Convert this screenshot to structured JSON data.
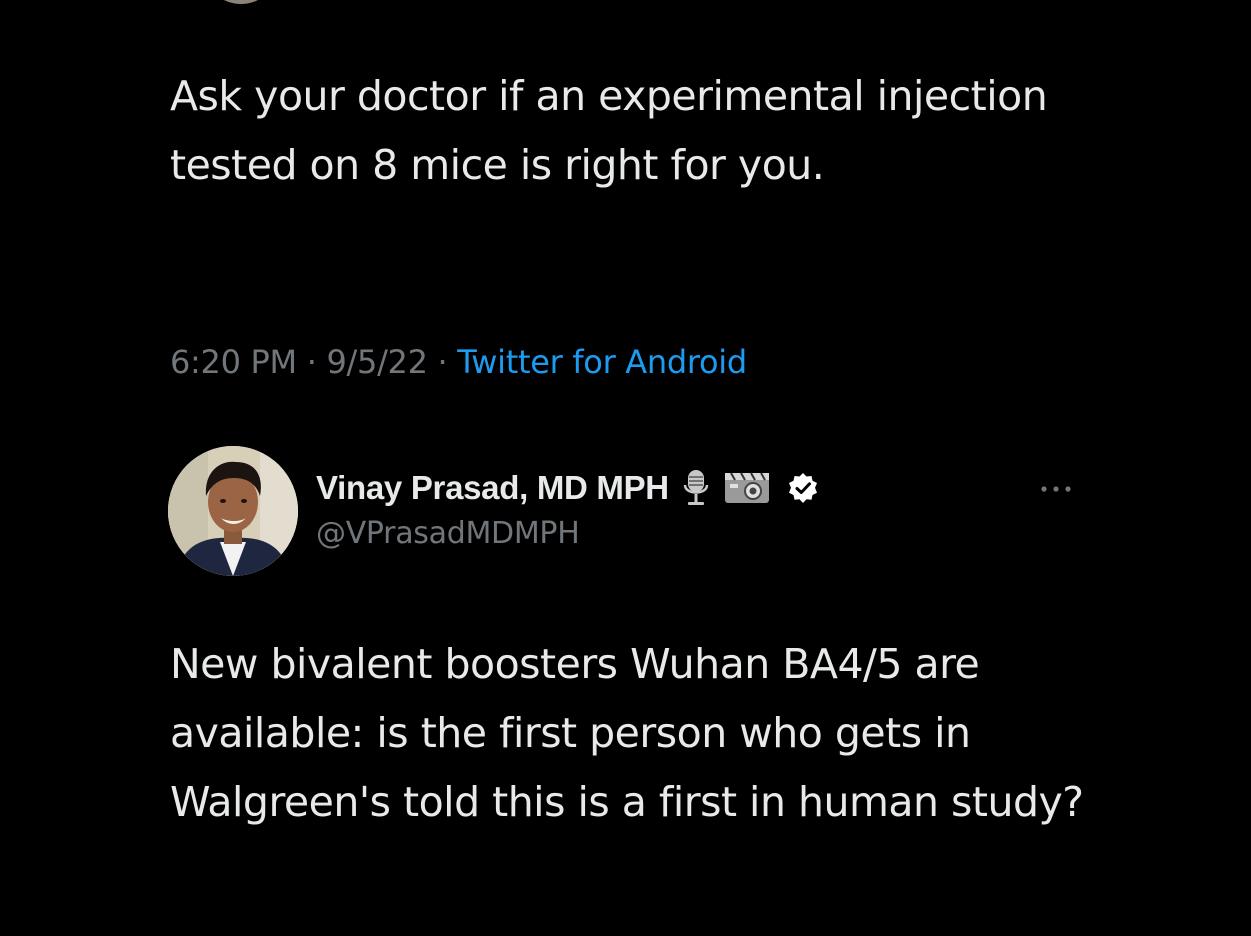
{
  "first_tweet": {
    "text": "Ask your doctor if an experimental injection tested on 8 mice is right for you.",
    "time": "6:20 PM",
    "separator_1": " · ",
    "date": "9/5/22",
    "separator_2": " · ",
    "source": "Twitter for Android"
  },
  "second_tweet": {
    "author": {
      "display_name": "Vinay Prasad, MD MPH",
      "handle": "@VPrasadMDMPH",
      "badges": [
        "microphone-icon",
        "movie-camera-icon",
        "verified-badge-icon"
      ]
    },
    "more_icon": "more-options-icon",
    "text": "New bivalent boosters Wuhan BA4/5 are available: is the first person who gets in Walgreen's told this is a first in human study?"
  },
  "colors": {
    "background": "#000000",
    "primary_text": "#e7e9ea",
    "secondary_text": "#71767b",
    "link": "#1d9bf0"
  }
}
